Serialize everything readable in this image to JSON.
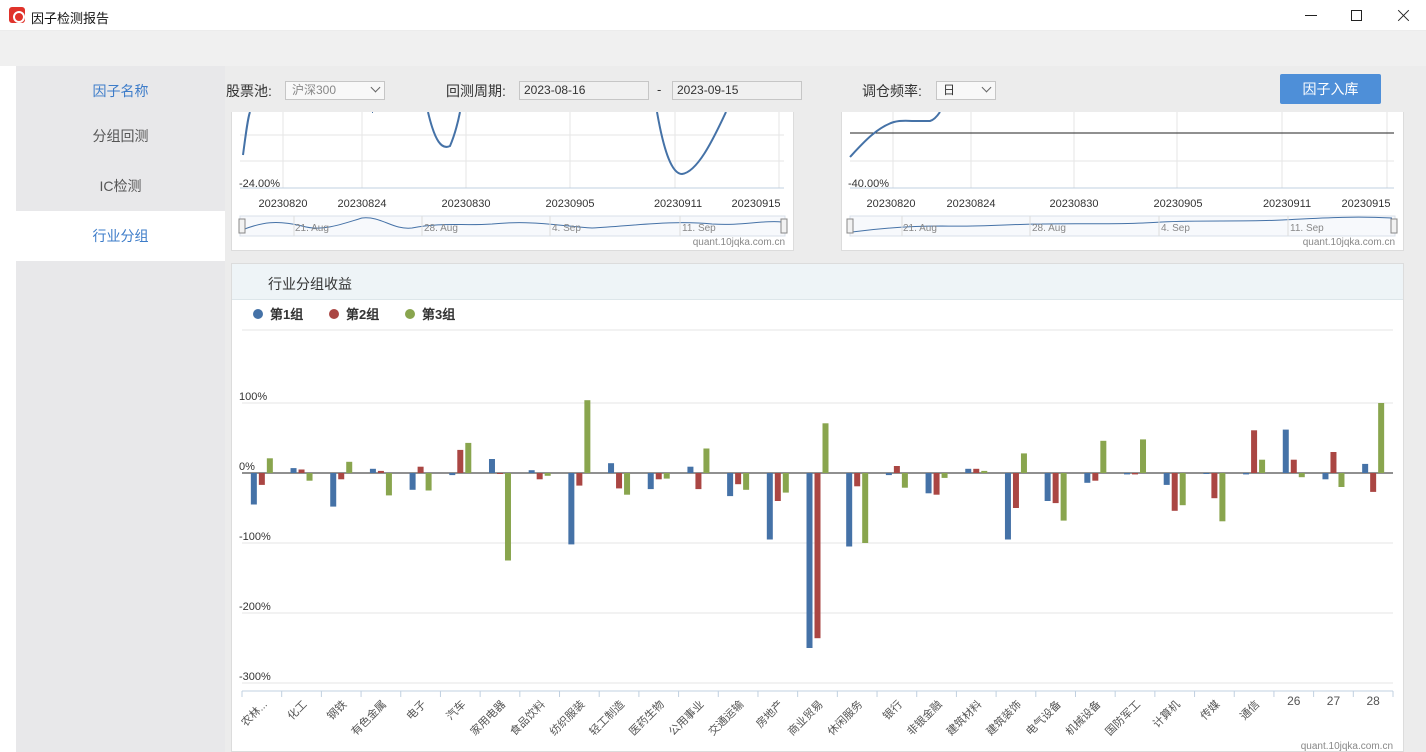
{
  "window": {
    "title": "因子检测报告"
  },
  "sidebar": {
    "items": [
      {
        "label": "因子名称"
      },
      {
        "label": "分组回测"
      },
      {
        "label": "IC检测"
      },
      {
        "label": "行业分组"
      }
    ]
  },
  "toolbar": {
    "pool_label": "股票池:",
    "pool_value": "沪深300",
    "period_label": "回测周期:",
    "start_date": "2023-08-16",
    "sep": "-",
    "end_date": "2023-09-15",
    "freq_label": "调仓频率:",
    "freq_value": "日",
    "submit_label": "因子入库"
  },
  "top_left_chart": {
    "y_label": "-24.00%",
    "x_ticks": [
      "20230820",
      "20230824",
      "20230830",
      "20230905",
      "20230911",
      "20230915"
    ],
    "nav_ticks": [
      "21. Aug",
      "28. Aug",
      "4. Sep",
      "11. Sep"
    ],
    "credit": "quant.10jqka.com.cn"
  },
  "top_right_chart": {
    "y_label": "-40.00%",
    "x_ticks": [
      "20230820",
      "20230824",
      "20230830",
      "20230905",
      "20230911",
      "20230915"
    ],
    "nav_ticks": [
      "21. Aug",
      "28. Aug",
      "4. Sep",
      "11. Sep"
    ],
    "credit": "quant.10jqka.com.cn"
  },
  "industry_panel": {
    "title": "行业分组收益",
    "credit": "quant.10jqka.com.cn"
  },
  "chart_data": {
    "type": "bar",
    "title": "行业分组收益",
    "yticks": [
      "100%",
      "0%",
      "-100%",
      "-200%",
      "-300%"
    ],
    "ylim": [
      -300,
      100
    ],
    "legend_position": "top-left",
    "grid": true,
    "categories": [
      "农林...",
      "化工",
      "钢铁",
      "有色金属",
      "电子",
      "汽车",
      "家用电器",
      "食品饮料",
      "纺织服装",
      "轻工制造",
      "医药生物",
      "公用事业",
      "交通运输",
      "房地产",
      "商业贸易",
      "休闲服务",
      "银行",
      "非银金融",
      "建筑材料",
      "建筑装饰",
      "电气设备",
      "机械设备",
      "国防军工",
      "计算机",
      "传媒",
      "通信",
      "26",
      "27",
      "28"
    ],
    "series": [
      {
        "name": "第1组",
        "color": "#4572a7",
        "values": [
          -45,
          7,
          -48,
          6,
          -24,
          -3,
          20,
          4,
          -102,
          14,
          -23,
          9,
          -33,
          -95,
          -250,
          -105,
          -3,
          -29,
          6,
          -95,
          -40,
          -14,
          -2,
          -17,
          0,
          -2,
          62,
          -9,
          13
        ]
      },
      {
        "name": "第2组",
        "color": "#aa4643",
        "values": [
          -17,
          5,
          -9,
          3,
          9,
          33,
          0,
          -9,
          -18,
          -22,
          -9,
          -23,
          -16,
          -40,
          -236,
          -19,
          10,
          -31,
          6,
          -50,
          -43,
          -11,
          -2,
          -54,
          -36,
          61,
          19,
          30,
          -27
        ]
      },
      {
        "name": "第3组",
        "color": "#89a54e",
        "values": [
          21,
          -11,
          16,
          -32,
          -25,
          43,
          -125,
          -4,
          104,
          -31,
          -8,
          35,
          -24,
          -28,
          71,
          -100,
          -21,
          -7,
          3,
          28,
          -68,
          46,
          48,
          -46,
          -69,
          19,
          -6,
          -20,
          100
        ]
      }
    ]
  }
}
